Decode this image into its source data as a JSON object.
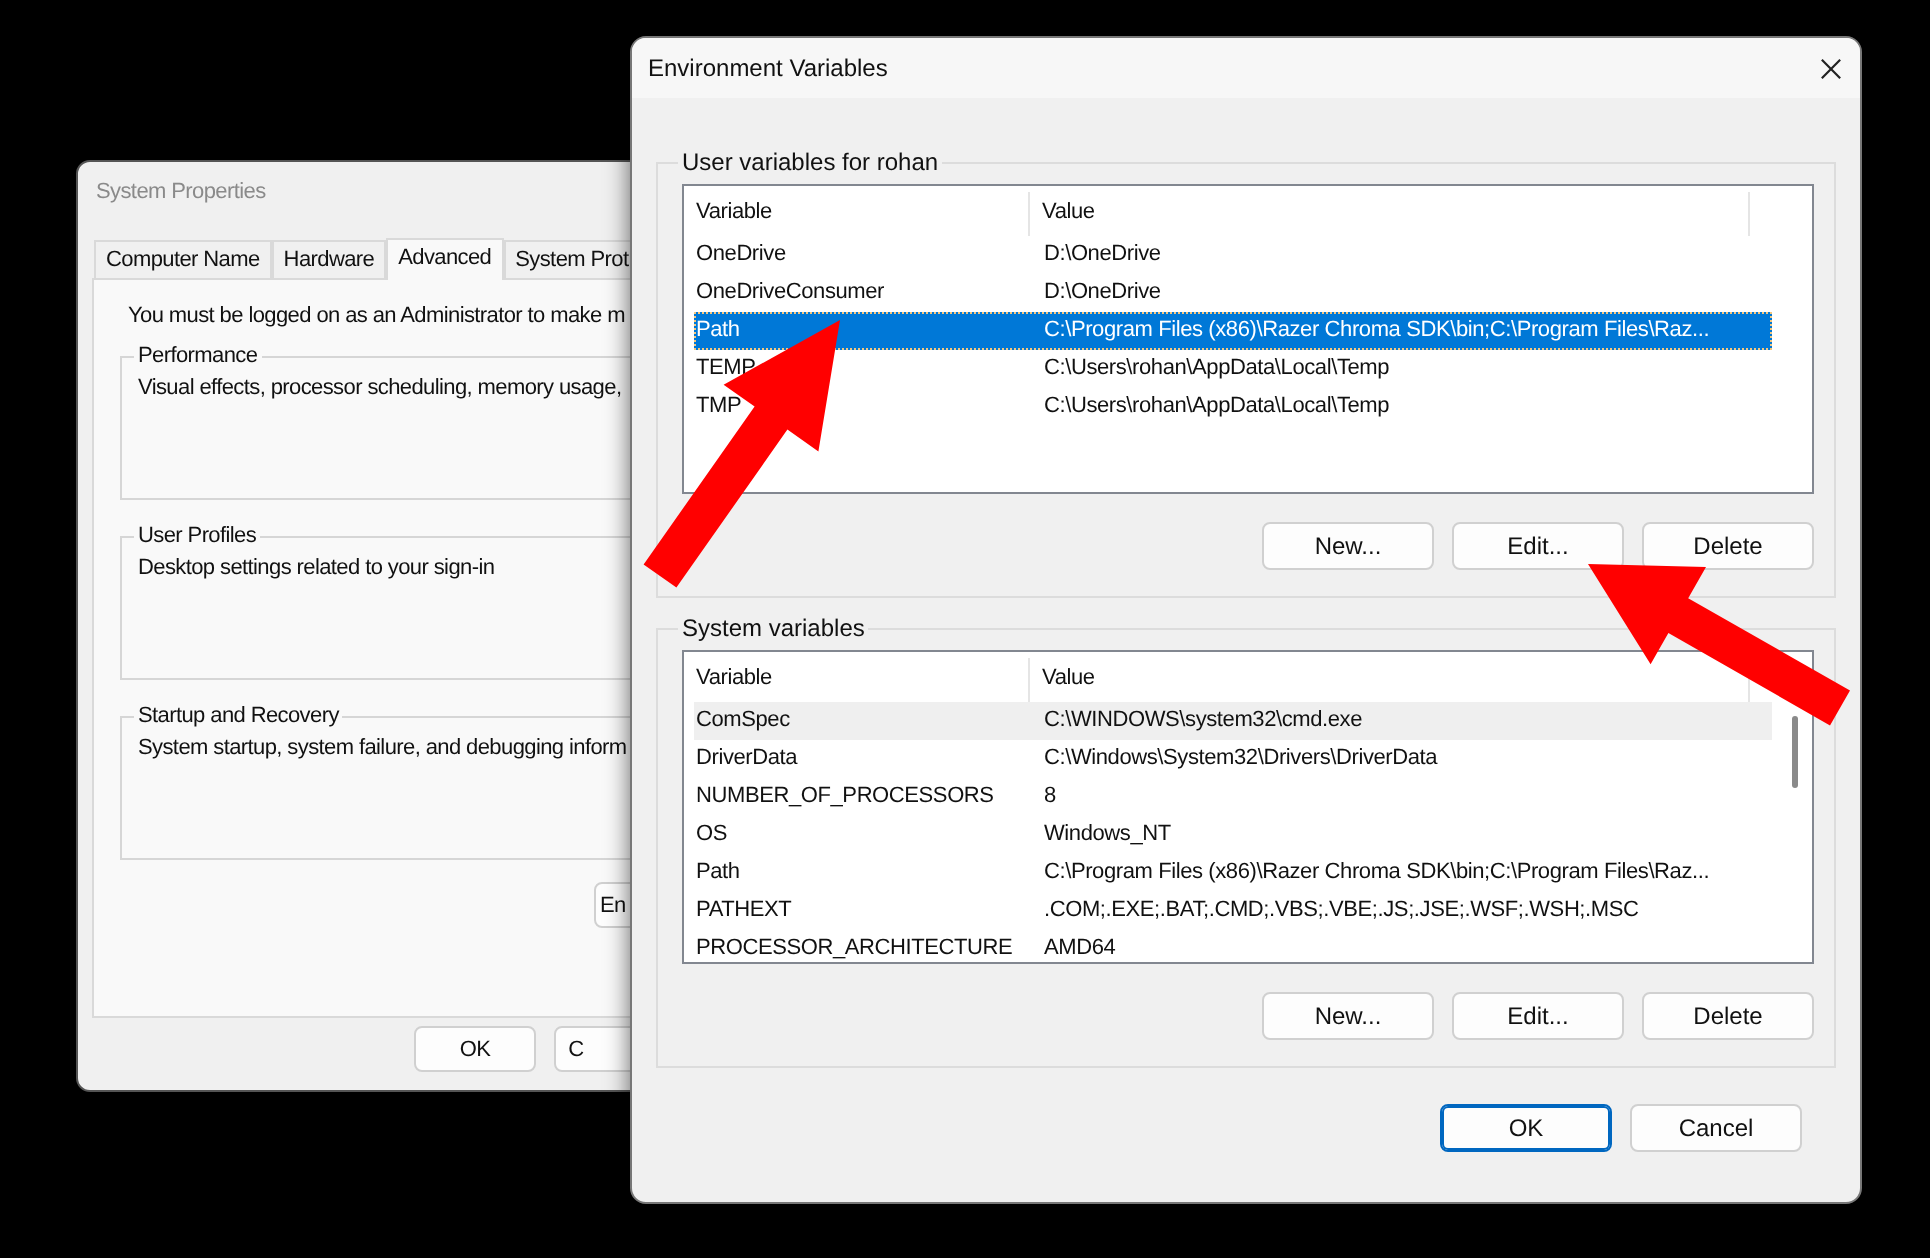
{
  "system_properties": {
    "title": "System Properties",
    "tabs": [
      {
        "label": "Computer Name",
        "selected": false
      },
      {
        "label": "Hardware",
        "selected": false
      },
      {
        "label": "Advanced",
        "selected": true
      },
      {
        "label": "System Prot",
        "selected": false
      }
    ],
    "notice": "You must be logged on as an Administrator to make m",
    "groups": [
      {
        "title": "Performance",
        "description": "Visual effects, processor scheduling, memory usage,"
      },
      {
        "title": "User Profiles",
        "description": "Desktop settings related to your sign-in"
      },
      {
        "title": "Startup and Recovery",
        "description": "System startup, system failure, and debugging inform"
      }
    ],
    "panel_button": "En",
    "buttons": [
      "OK",
      "C"
    ]
  },
  "environment_variables": {
    "title": "Environment Variables",
    "lists": [
      {
        "title": "User variables for rohan",
        "focused": true,
        "columns": [
          "Variable",
          "Value"
        ],
        "rows": [
          {
            "variable": "OneDrive",
            "value": "D:\\OneDrive",
            "selected": false
          },
          {
            "variable": "OneDriveConsumer",
            "value": "D:\\OneDrive",
            "selected": false
          },
          {
            "variable": "Path",
            "value": "C:\\Program Files (x86)\\Razer Chroma SDK\\bin;C:\\Program Files\\Raz...",
            "selected": true
          },
          {
            "variable": "TEMP",
            "value": "C:\\Users\\rohan\\AppData\\Local\\Temp",
            "selected": false
          },
          {
            "variable": "TMP",
            "value": "C:\\Users\\rohan\\AppData\\Local\\Temp",
            "selected": false
          }
        ],
        "buttons": [
          "New...",
          "Edit...",
          "Delete"
        ]
      },
      {
        "title": "System variables",
        "focused": false,
        "columns": [
          "Variable",
          "Value"
        ],
        "rows": [
          {
            "variable": "ComSpec",
            "value": "C:\\WINDOWS\\system32\\cmd.exe",
            "selected": true
          },
          {
            "variable": "DriverData",
            "value": "C:\\Windows\\System32\\Drivers\\DriverData",
            "selected": false
          },
          {
            "variable": "NUMBER_OF_PROCESSORS",
            "value": "8",
            "selected": false
          },
          {
            "variable": "OS",
            "value": "Windows_NT",
            "selected": false
          },
          {
            "variable": "Path",
            "value": "C:\\Program Files (x86)\\Razer Chroma SDK\\bin;C:\\Program Files\\Raz...",
            "selected": false
          },
          {
            "variable": "PATHEXT",
            "value": ".COM;.EXE;.BAT;.CMD;.VBS;.VBE;.JS;.JSE;.WSF;.WSH;.MSC",
            "selected": false
          },
          {
            "variable": "PROCESSOR_ARCHITECTURE",
            "value": "AMD64",
            "selected": false
          }
        ],
        "buttons": [
          "New...",
          "Edit...",
          "Delete"
        ]
      }
    ],
    "buttons": [
      {
        "label": "OK",
        "default": true
      },
      {
        "label": "Cancel",
        "default": false
      }
    ]
  },
  "annotations": [
    {
      "kind": "arrow"
    },
    {
      "kind": "arrow"
    }
  ]
}
